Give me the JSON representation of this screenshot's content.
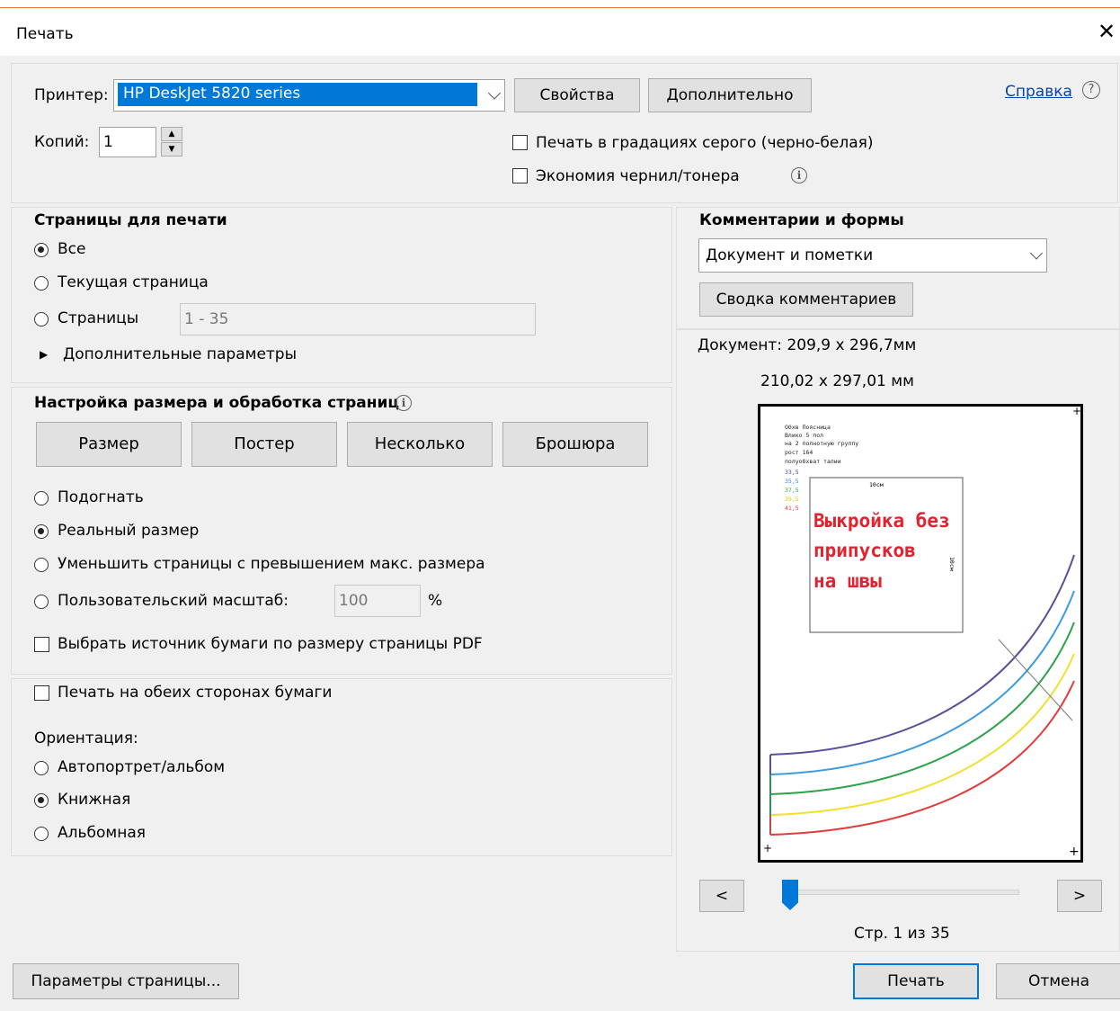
{
  "dialog": {
    "title": "Печать"
  },
  "printer": {
    "label": "Принтер:",
    "selected": "HP DeskJet 5820 series",
    "properties_button": "Свойства",
    "advanced_button": "Дополнительно",
    "help_link": "Справка",
    "copies_label": "Копий:",
    "copies_value": "1",
    "grayscale_label": "Печать в градациях серого (черно-белая)",
    "ink_saving_label": "Экономия чернил/тонера"
  },
  "pages": {
    "heading": "Страницы для печати",
    "all": "Все",
    "current": "Текущая страница",
    "range_label": "Страницы",
    "range_value": "1 - 35",
    "more_options": "Дополнительные параметры"
  },
  "sizing": {
    "heading": "Настройка размера и обработка страниц",
    "tabs": [
      "Размер",
      "Постер",
      "Несколько",
      "Брошюра"
    ],
    "fit": "Подогнать",
    "actual": "Реальный размер",
    "shrink": "Уменьшить страницы с превышением макс. размера",
    "custom": "Пользовательский масштаб:",
    "custom_value": "100",
    "percent": "%",
    "paper_source": "Выбрать источник бумаги по размеру страницы PDF"
  },
  "duplex": {
    "label": "Печать на обеих сторонах бумаги"
  },
  "orientation": {
    "heading": "Ориентация:",
    "auto": "Автопортрет/альбом",
    "portrait": "Книжная",
    "landscape": "Альбомная"
  },
  "comments": {
    "heading": "Комментарии и формы",
    "selected": "Документ и пометки",
    "summary_button": "Сводка комментариев"
  },
  "preview": {
    "document_size": "Документ: 209,9 x 296,7мм",
    "paper_size": "210,02 x 297,01 мм",
    "page_indicator": "Стр. 1 из 35",
    "prev": "<",
    "next": ">",
    "slider_fraction": 0.0,
    "sheet": {
      "notes": [
        "Обхв Поясница",
        "Влико 5 пол",
        "на 2 полнотную группу",
        "рост 164",
        "полуобхват талии"
      ],
      "sizes": [
        "33,5",
        "35,5",
        "37,5",
        "39,5",
        "41,5"
      ],
      "box_label": "10см",
      "box_side_label": "10см",
      "red_text_lines": [
        "Выкройка без",
        "припусков",
        "на швы"
      ]
    }
  },
  "footer": {
    "page_setup": "Параметры страницы...",
    "print": "Печать",
    "cancel": "Отмена"
  },
  "colors": {
    "accent": "#0078d7",
    "red_text": "#e2222f",
    "curves": [
      "#5a4f9c",
      "#3d9be0",
      "#2ca24a",
      "#f2df2e",
      "#e33b3b"
    ]
  }
}
